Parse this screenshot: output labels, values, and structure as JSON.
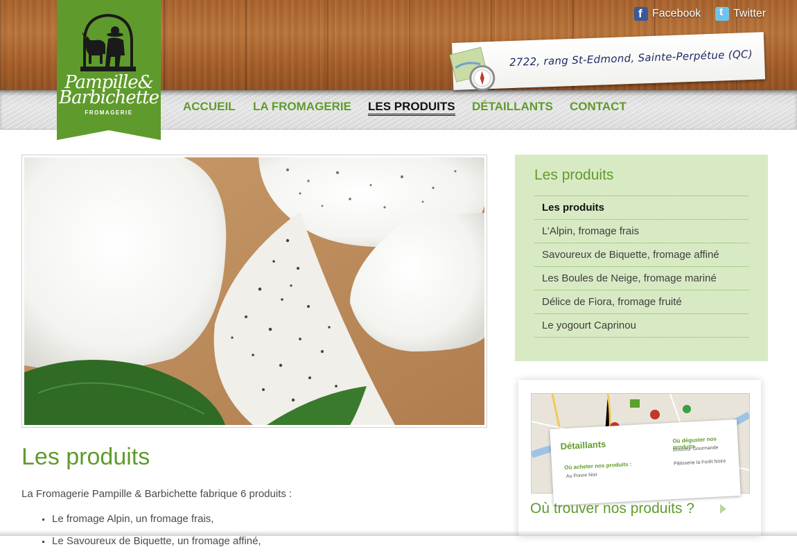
{
  "brand": {
    "line1": "Pampille&",
    "line2": "Barbichette",
    "subtitle": "FROMAGERIE",
    "color": "#5f9b2c"
  },
  "social": {
    "facebook": "Facebook",
    "twitter": "Twitter"
  },
  "address": "2722, rang St-Edmond, Sainte-Perpétue (QC)",
  "nav": {
    "items": [
      {
        "label": "ACCUEIL",
        "active": false
      },
      {
        "label": "LA FROMAGERIE",
        "active": false
      },
      {
        "label": "LES PRODUITS",
        "active": true
      },
      {
        "label": "DÉTAILLANTS",
        "active": false
      },
      {
        "label": "CONTACT",
        "active": false
      }
    ]
  },
  "main": {
    "title": "Les produits",
    "intro": "La Fromagerie Pampille & Barbichette fabrique 6 produits :",
    "bullets": [
      "Le fromage Alpin, un fromage frais,",
      "Le Savoureux de Biquette, un fromage affiné,"
    ]
  },
  "sidebar": {
    "title": "Les produits",
    "items": [
      {
        "label": "Les produits",
        "current": true
      },
      {
        "label": "L’Alpin, fromage frais",
        "current": false
      },
      {
        "label": "Savoureux de Biquette, fromage affiné",
        "current": false
      },
      {
        "label": "Les Boules de Neige, fromage mariné",
        "current": false
      },
      {
        "label": "Délice de Fiora, fromage fruité",
        "current": false
      },
      {
        "label": "Le yogourt Caprinou",
        "current": false
      }
    ]
  },
  "promo": {
    "card_title": "Détaillants",
    "buy_heading": "Où acheter nos produits :",
    "buy_line": "Au Poivre Noir",
    "taste_heading": "Où déguster nos produits",
    "taste_line1": "Douceur Gourmande",
    "taste_line2": "Pâtisserie la Forêt Noire",
    "cta": "Où trouver nos produits ?"
  },
  "colors": {
    "green": "#5f9b2c",
    "sidebar_bg": "#d8eac3",
    "text": "#4a4a4a"
  }
}
